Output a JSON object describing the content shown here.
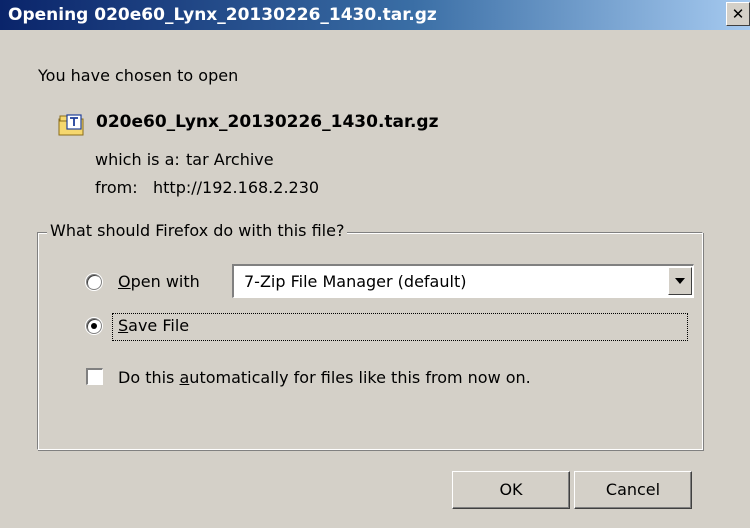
{
  "window": {
    "title": "Opening 020e60_Lynx_20130226_1430.tar.gz",
    "close_glyph": "✕"
  },
  "intro": "You have chosen to open",
  "file": {
    "name": "020e60_Lynx_20130226_1430.tar.gz",
    "type_label": "which is a:",
    "type_value": "tar Archive",
    "from_label": "from:",
    "from_value": "http://192.168.2.230",
    "icon": "archive-file-icon"
  },
  "action_group": {
    "legend": "What should Firefox do with this file?",
    "open_with": {
      "label_pre": "",
      "label_accel": "O",
      "label_post": "pen with",
      "selected": false,
      "app": "7-Zip File Manager (default)"
    },
    "save_file": {
      "label_accel": "S",
      "label_post": "ave File",
      "selected": true
    },
    "auto": {
      "label_pre": "Do this ",
      "label_accel": "a",
      "label_post": "utomatically for files like this from now on.",
      "checked": false
    }
  },
  "buttons": {
    "ok": "OK",
    "cancel": "Cancel"
  },
  "colors": {
    "face": "#d4d0c8",
    "title_start": "#0a246a",
    "title_end": "#a6caf0"
  }
}
